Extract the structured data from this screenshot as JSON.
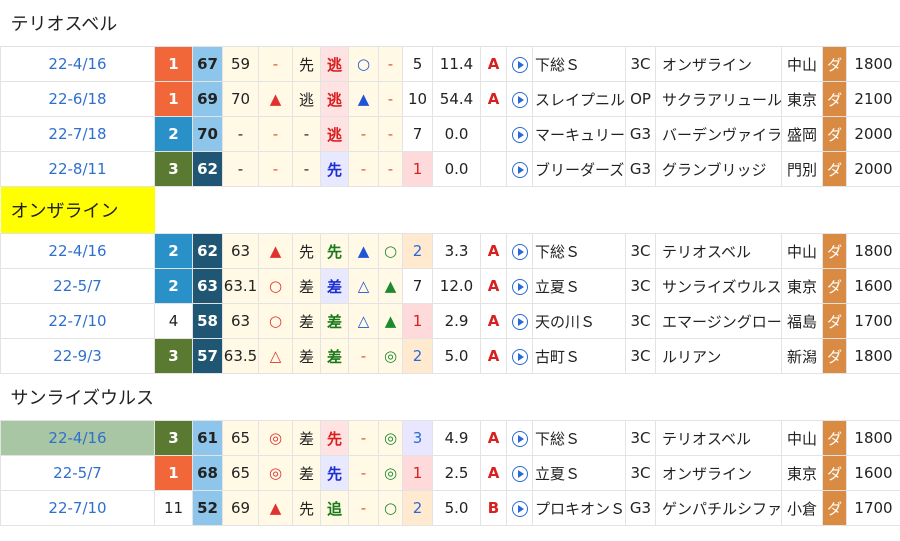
{
  "groups": [
    {
      "horse": "テリオスベル",
      "highlight": false,
      "rows": [
        {
          "date": "22-4/16",
          "rank": "1",
          "rc": "r1",
          "score": "67",
          "sc": "sl",
          "idx": "59",
          "m1": "-",
          "m1c": "dash",
          "pos": "先",
          "style": "逃",
          "stc": "nige",
          "m2": "○",
          "m2c": "blu",
          "m3": "-",
          "m3c": "dash",
          "pop": "5",
          "poc": "",
          "odds": "11.4",
          "grade": "A",
          "race": "下総Ｓ",
          "cls": "3C",
          "opp": "オンザライン",
          "course": "中山",
          "surf": "ダ",
          "dist": "1800",
          "datehl": false
        },
        {
          "date": "22-6/18",
          "rank": "1",
          "rc": "r1",
          "score": "69",
          "sc": "sl",
          "idx": "70",
          "m1": "▲",
          "m1c": "red",
          "pos": "逃",
          "style": "逃",
          "stc": "nige",
          "m2": "▲",
          "m2c": "blu",
          "m3": "-",
          "m3c": "dash",
          "pop": "10",
          "poc": "",
          "odds": "54.4",
          "grade": "A",
          "race": "スレイプニル",
          "cls": "OP",
          "opp": "サクラアリュール",
          "course": "東京",
          "surf": "ダ",
          "dist": "2100",
          "datehl": false
        },
        {
          "date": "22-7/18",
          "rank": "2",
          "rc": "r2",
          "score": "70",
          "sc": "sl",
          "idx": "-",
          "m1": "-",
          "m1c": "dash",
          "pos": "-",
          "style": "逃",
          "stc": "nige",
          "m2": "-",
          "m2c": "dash",
          "m3": "-",
          "m3c": "dash",
          "pop": "7",
          "poc": "",
          "odds": "0.0",
          "grade": "",
          "race": "マーキュリー",
          "cls": "G3",
          "opp": "バーデンヴァイラー",
          "course": "盛岡",
          "surf": "ダ",
          "dist": "2000",
          "datehl": false
        },
        {
          "date": "22-8/11",
          "rank": "3",
          "rc": "r3",
          "score": "62",
          "sc": "sd",
          "idx": "-",
          "m1": "-",
          "m1c": "dash",
          "pos": "-",
          "style": "先",
          "stc": "sen",
          "m2": "-",
          "m2c": "dash",
          "m3": "-",
          "m3c": "dash",
          "pop": "1",
          "poc": "po-r",
          "odds": "0.0",
          "grade": "",
          "race": "ブリーダーズ",
          "cls": "G3",
          "opp": "グランブリッジ",
          "course": "門別",
          "surf": "ダ",
          "dist": "2000",
          "datehl": false
        }
      ]
    },
    {
      "horse": "オンザライン",
      "highlight": true,
      "rows": [
        {
          "date": "22-4/16",
          "rank": "2",
          "rc": "r2",
          "score": "62",
          "sc": "sd",
          "idx": "63",
          "m1": "▲",
          "m1c": "red",
          "pos": "先",
          "style": "先",
          "stc": "sashi",
          "m2": "▲",
          "m2c": "blu",
          "m3": "○",
          "m3c": "grn",
          "pop": "2",
          "poc": "po-o",
          "odds": "3.3",
          "grade": "A",
          "race": "下総Ｓ",
          "cls": "3C",
          "opp": "テリオスベル",
          "course": "中山",
          "surf": "ダ",
          "dist": "1800",
          "datehl": false
        },
        {
          "date": "22-5/7",
          "rank": "2",
          "rc": "r2",
          "score": "63",
          "sc": "sd",
          "idx": "63.1",
          "m1": "○",
          "m1c": "red",
          "pos": "差",
          "style": "差",
          "stc": "sen",
          "m2": "△",
          "m2c": "blu",
          "m3": "▲",
          "m3c": "grn",
          "pop": "7",
          "poc": "",
          "odds": "12.0",
          "grade": "A",
          "race": "立夏Ｓ",
          "cls": "3C",
          "opp": "サンライズウルス",
          "course": "東京",
          "surf": "ダ",
          "dist": "1600",
          "datehl": false
        },
        {
          "date": "22-7/10",
          "rank": "4",
          "rc": "rn",
          "score": "58",
          "sc": "sd",
          "idx": "63",
          "m1": "○",
          "m1c": "red",
          "pos": "差",
          "style": "差",
          "stc": "sashi",
          "m2": "△",
          "m2c": "blu",
          "m3": "▲",
          "m3c": "grn",
          "pop": "1",
          "poc": "po-r",
          "odds": "2.9",
          "grade": "A",
          "race": "天の川Ｓ",
          "cls": "3C",
          "opp": "エマージングロール",
          "course": "福島",
          "surf": "ダ",
          "dist": "1700",
          "datehl": false
        },
        {
          "date": "22-9/3",
          "rank": "3",
          "rc": "r3",
          "score": "57",
          "sc": "sd",
          "idx": "63.5",
          "m1": "△",
          "m1c": "red",
          "pos": "差",
          "style": "差",
          "stc": "sashi",
          "m2": "-",
          "m2c": "dash",
          "m3": "◎",
          "m3c": "grn",
          "pop": "2",
          "poc": "po-o",
          "odds": "5.0",
          "grade": "A",
          "race": "古町Ｓ",
          "cls": "3C",
          "opp": "ルリアン",
          "course": "新潟",
          "surf": "ダ",
          "dist": "1800",
          "datehl": false
        }
      ]
    },
    {
      "horse": "サンライズウルス",
      "highlight": false,
      "rows": [
        {
          "date": "22-4/16",
          "rank": "3",
          "rc": "r3",
          "score": "61",
          "sc": "sl",
          "idx": "65",
          "m1": "◎",
          "m1c": "red",
          "pos": "差",
          "style": "先",
          "stc": "nige",
          "m2": "-",
          "m2c": "dash",
          "m3": "◎",
          "m3c": "grn",
          "pop": "3",
          "poc": "po-p",
          "odds": "4.9",
          "grade": "A",
          "race": "下総Ｓ",
          "cls": "3C",
          "opp": "テリオスベル",
          "course": "中山",
          "surf": "ダ",
          "dist": "1800",
          "datehl": true
        },
        {
          "date": "22-5/7",
          "rank": "1",
          "rc": "r1",
          "score": "68",
          "sc": "sl",
          "idx": "65",
          "m1": "◎",
          "m1c": "red",
          "pos": "差",
          "style": "先",
          "stc": "sen",
          "m2": "-",
          "m2c": "dash",
          "m3": "◎",
          "m3c": "grn",
          "pop": "1",
          "poc": "po-r",
          "odds": "2.5",
          "grade": "A",
          "race": "立夏Ｓ",
          "cls": "3C",
          "opp": "オンザライン",
          "course": "東京",
          "surf": "ダ",
          "dist": "1600",
          "datehl": false
        },
        {
          "date": "22-7/10",
          "rank": "11",
          "rc": "rn",
          "score": "52",
          "sc": "sl",
          "idx": "69",
          "m1": "▲",
          "m1c": "red",
          "pos": "先",
          "style": "追",
          "stc": "sashi",
          "m2": "-",
          "m2c": "dash",
          "m3": "○",
          "m3c": "grn",
          "pop": "2",
          "poc": "po-o",
          "odds": "5.0",
          "grade": "B",
          "race": "プロキオンＳ",
          "cls": "G3",
          "opp": "ゲンパチルシファー",
          "course": "小倉",
          "surf": "ダ",
          "dist": "1700",
          "datehl": false
        }
      ]
    }
  ]
}
